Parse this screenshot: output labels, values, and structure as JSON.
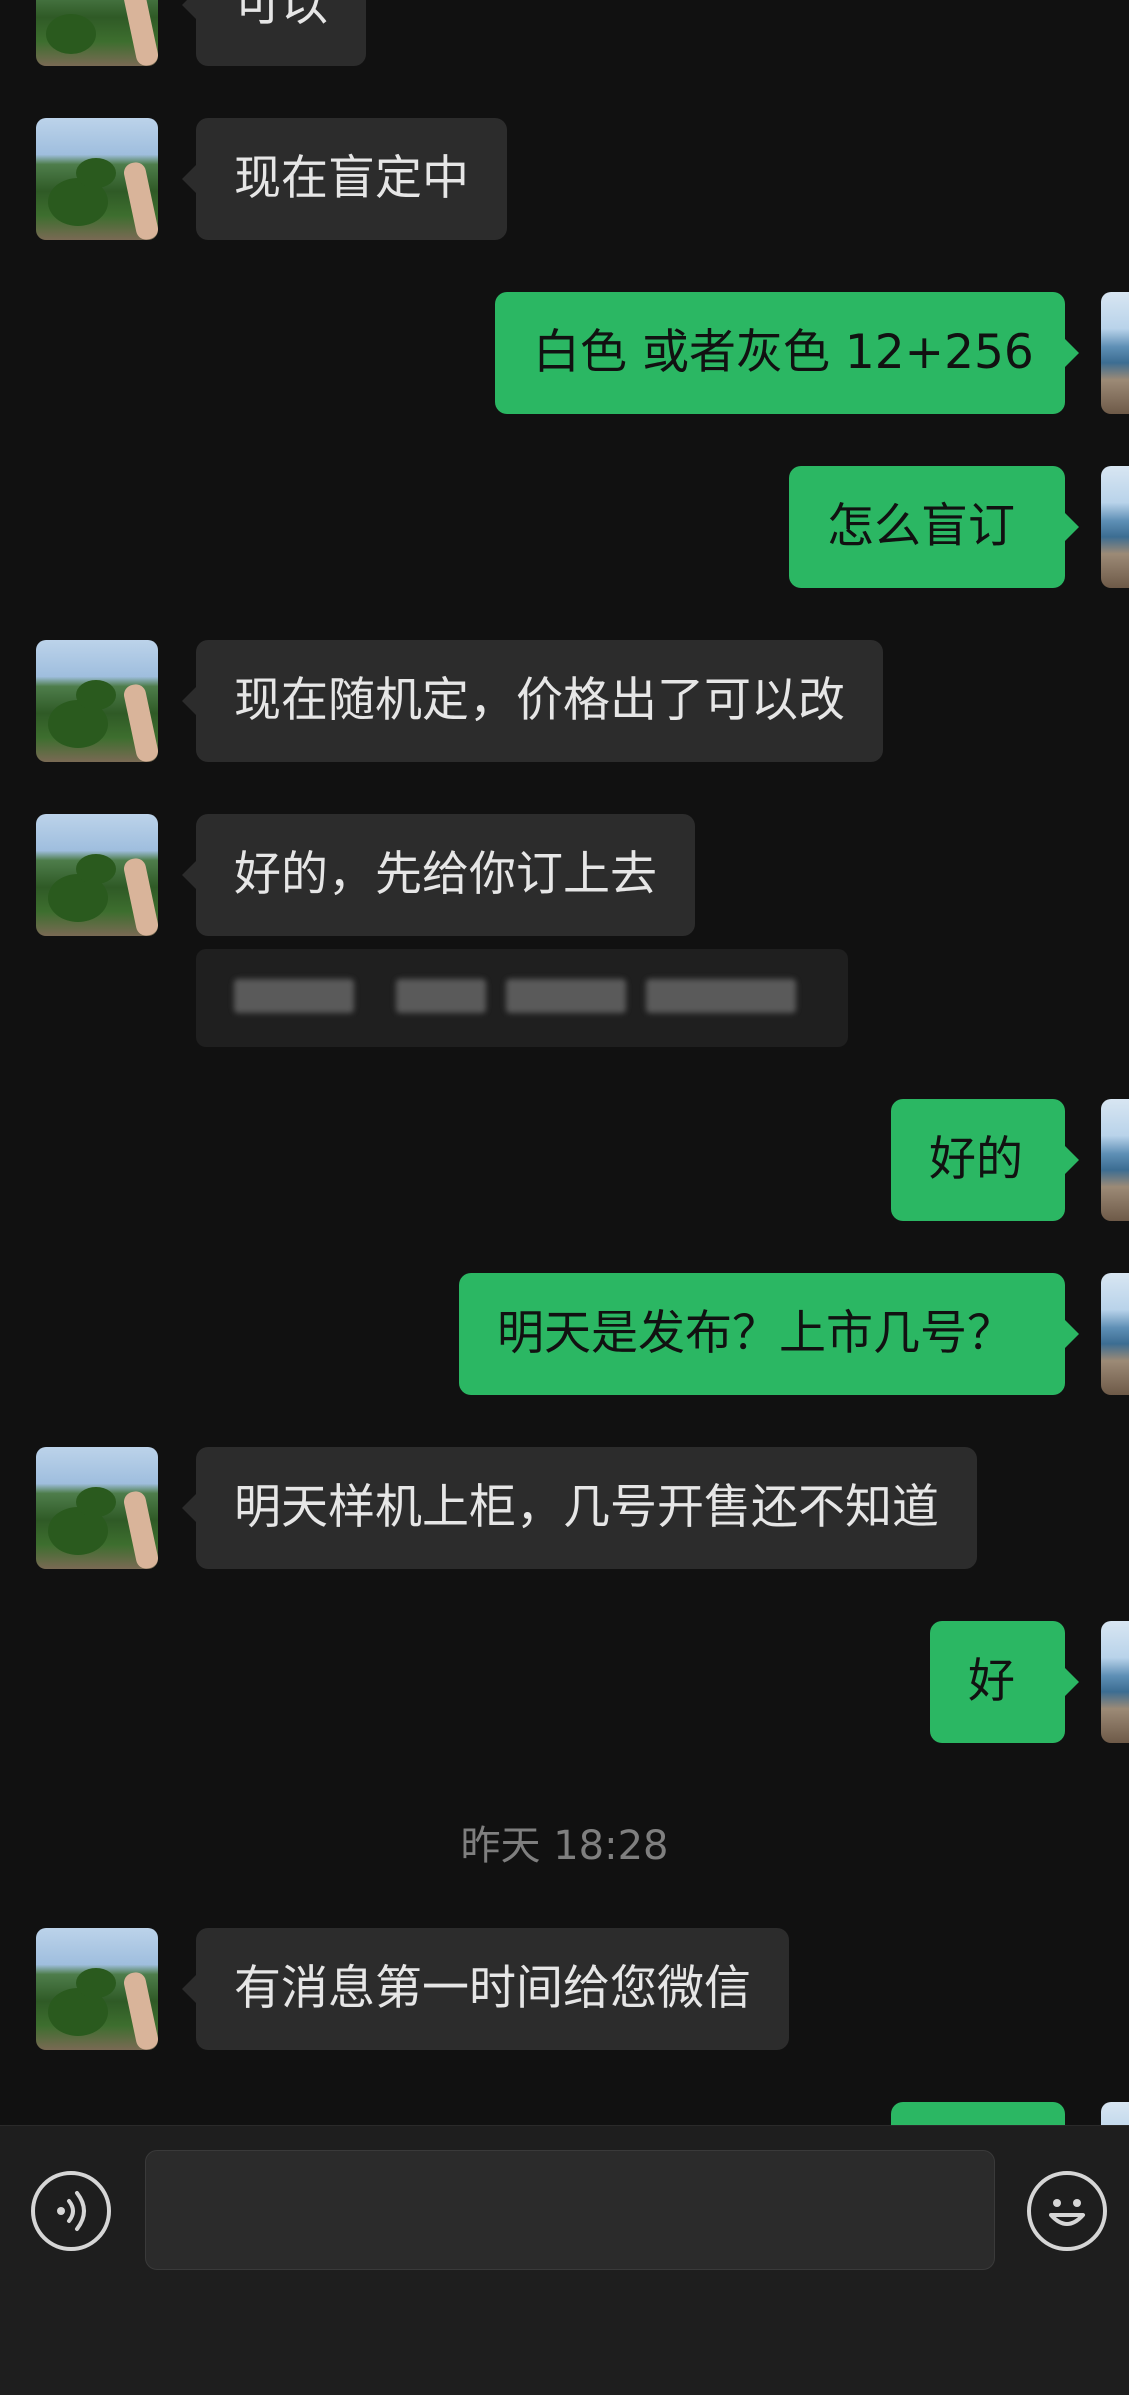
{
  "messages": [
    {
      "side": "in",
      "text": "可以"
    },
    {
      "side": "in",
      "text": "现在盲定中"
    },
    {
      "side": "out",
      "text": "白色 或者灰色 12+256"
    },
    {
      "side": "out",
      "text": "怎么盲订"
    },
    {
      "side": "in",
      "text": "现在随机定，价格出了可以改"
    },
    {
      "side": "in",
      "text": "好的，先给你订上去"
    },
    {
      "side": "out",
      "text": "好的"
    },
    {
      "side": "out",
      "text": "明天是发布？上市几号？"
    },
    {
      "side": "in",
      "text": "明天样机上柜，几号开售还不知道"
    },
    {
      "side": "out",
      "text": "好"
    },
    {
      "side": "in",
      "text": "有消息第一时间给您微信"
    }
  ],
  "timestamp": "昨天 18:28",
  "input": {
    "value": "",
    "placeholder": ""
  },
  "icons": {
    "voice": "voice-wave-icon",
    "emoji": "smiley-emoji-icon"
  },
  "colors": {
    "background": "#111111",
    "incoming_bubble": "#2c2c2c",
    "outgoing_bubble": "#2bb763"
  }
}
